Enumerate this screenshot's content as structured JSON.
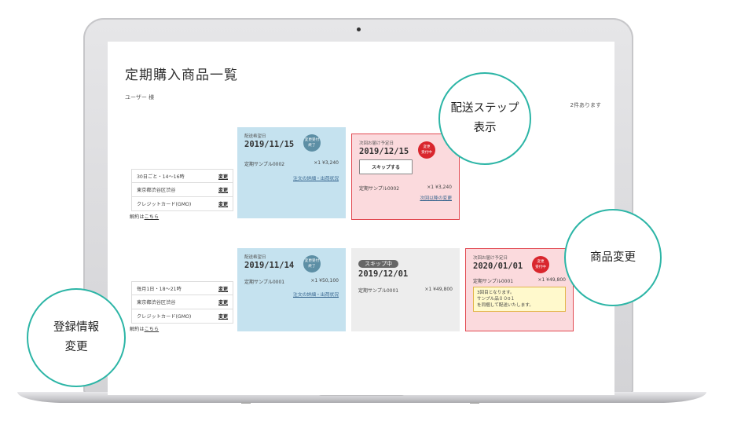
{
  "page": {
    "title": "定期購入商品一覧",
    "user": "ユーザー 様",
    "count": "2件あります"
  },
  "subscriptions": [
    {
      "registration": {
        "rows": [
          {
            "text": "30日ごと・14〜16時",
            "change": "変更"
          },
          {
            "text": "東京都渋谷区渋谷",
            "change": "変更"
          },
          {
            "text": "クレジットカード(GMO)",
            "change": "変更"
          }
        ],
        "cancel_prefix": "解約は",
        "cancel_link": "こちら"
      },
      "delivered": {
        "label": "配送希望日",
        "date": "2019/11/15",
        "badge": [
          "変更受付",
          "終了"
        ],
        "product": "定期サンプル0002",
        "qty_price": "×1 ¥3,240",
        "link": "注文の詳細・出荷状況"
      },
      "next": {
        "label": "次回お届け予定日",
        "date": "2019/12/15",
        "badge": [
          "変更",
          "受付中"
        ],
        "button": "スキップする",
        "product": "定期サンプル0002",
        "qty_price": "×1 ¥3,240",
        "link": "次回以降の変更"
      }
    },
    {
      "registration": {
        "rows": [
          {
            "text": "毎月1日・18〜21時",
            "change": "変更"
          },
          {
            "text": "東京都渋谷区渋谷",
            "change": "変更"
          },
          {
            "text": "クレジットカード(GMO)",
            "change": "変更"
          }
        ],
        "cancel_prefix": "解約は",
        "cancel_link": "こちら"
      },
      "delivered": {
        "label": "配送希望日",
        "date": "2019/11/14",
        "badge": [
          "変更受付",
          "終了"
        ],
        "product": "定期サンプル0001",
        "qty_price": "×1 ¥50,100",
        "link": "注文の詳細・出荷状況"
      },
      "skipped": {
        "pill": "スキップ中",
        "date": "2019/12/01",
        "product": "定期サンプル0001",
        "qty_price": "×1 ¥49,800"
      },
      "next": {
        "label": "次回お届け予定日",
        "date": "2020/01/01",
        "badge": [
          "変更",
          "受付中"
        ],
        "product": "定期サンプル0001",
        "qty_price": "×1 ¥49,800",
        "note": [
          "3回目となります。",
          "サンプル品００0１",
          "を同梱して配送いたします。"
        ]
      }
    }
  ],
  "callouts": {
    "delivery_step": [
      "配送ステップ",
      "表示"
    ],
    "product_change": "商品変更",
    "registration_change": [
      "登録情報",
      "変更"
    ]
  },
  "colors": {
    "accent_teal": "#2cb5a6",
    "card_blue": "#c5e2ef",
    "card_pink": "#fbdadd",
    "badge_red": "#d9262d",
    "badge_teal": "#5d8fa5"
  }
}
